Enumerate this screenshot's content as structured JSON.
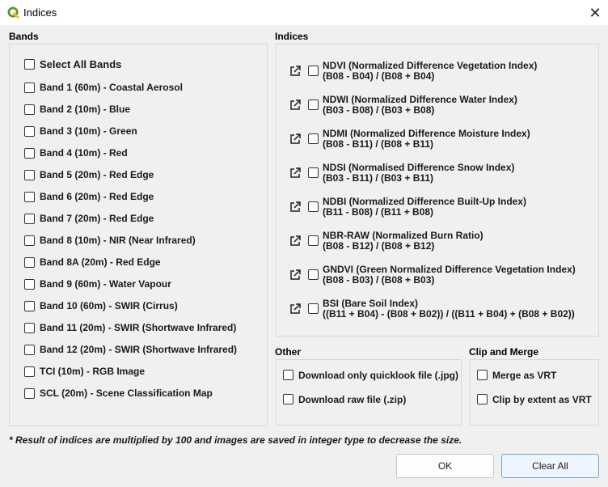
{
  "window": {
    "title": "Indices",
    "close_glyph": "✕"
  },
  "bands": {
    "heading": "Bands",
    "select_all": "Select All Bands",
    "items": [
      "Band 1 (60m) - Coastal Aerosol",
      "Band 2 (10m) - Blue",
      "Band 3 (10m) - Green",
      "Band 4  (10m) - Red",
      "Band 5 (20m) - Red Edge",
      "Band 6 (20m) - Red Edge",
      "Band 7 (20m) - Red Edge",
      "Band 8 (10m) - NIR (Near Infrared)",
      "Band 8A (20m) - Red Edge",
      "Band 9 (60m) - Water Vapour",
      "Band 10 (60m) - SWIR (Cirrus)",
      "Band 11 (20m) - SWIR (Shortwave Infrared)",
      "Band 12 (20m) - SWIR (Shortwave Infrared)",
      "TCI (10m) - RGB Image",
      "SCL (20m) - Scene Classification Map"
    ]
  },
  "indices": {
    "heading": "Indices",
    "items": [
      {
        "name": "NDVI (Normalized Difference Vegetation Index)",
        "formula": "(B08 - B04) / (B08 + B04)"
      },
      {
        "name": "NDWI (Normalized Difference Water Index)",
        "formula": "(B03 - B08) / (B03 + B08)"
      },
      {
        "name": "NDMI (Normalized Difference Moisture Index)",
        "formula": "(B08 - B11) / (B08 + B11)"
      },
      {
        "name": "NDSI (Normalised Difference Snow Index)",
        "formula": "(B03 - B11) / (B03 + B11)"
      },
      {
        "name": "NDBI (Normalized Difference Built-Up Index)",
        "formula": "(B11 - B08) / (B11 + B08)"
      },
      {
        "name": "NBR-RAW (Normalized Burn Ratio)",
        "formula": "(B08 - B12) / (B08 + B12)"
      },
      {
        "name": "GNDVI (Green Normalized Difference Vegetation Index)",
        "formula": "(B08 - B03) / (B08 + B03)"
      },
      {
        "name": "BSI (Bare Soil Index)",
        "formula": "((B11 + B04) - (B08 + B02)) / ((B11 + B04) + (B08 + B02))"
      }
    ]
  },
  "other": {
    "heading": "Other",
    "items": [
      "Download only quicklook file (.jpg)",
      "Download raw file (.zip)"
    ]
  },
  "clip": {
    "heading": "Clip and Merge",
    "items": [
      "Merge as VRT",
      "Clip by extent as VRT"
    ]
  },
  "note": "* Result of indices are multiplied by 100 and images are saved in integer type to decrease the size.",
  "buttons": {
    "ok": "OK",
    "clear": "Clear All"
  },
  "colors": {
    "logo_green": "#589632",
    "logo_yellow": "#f0c419",
    "default_button_border": "#6aa6dc"
  }
}
